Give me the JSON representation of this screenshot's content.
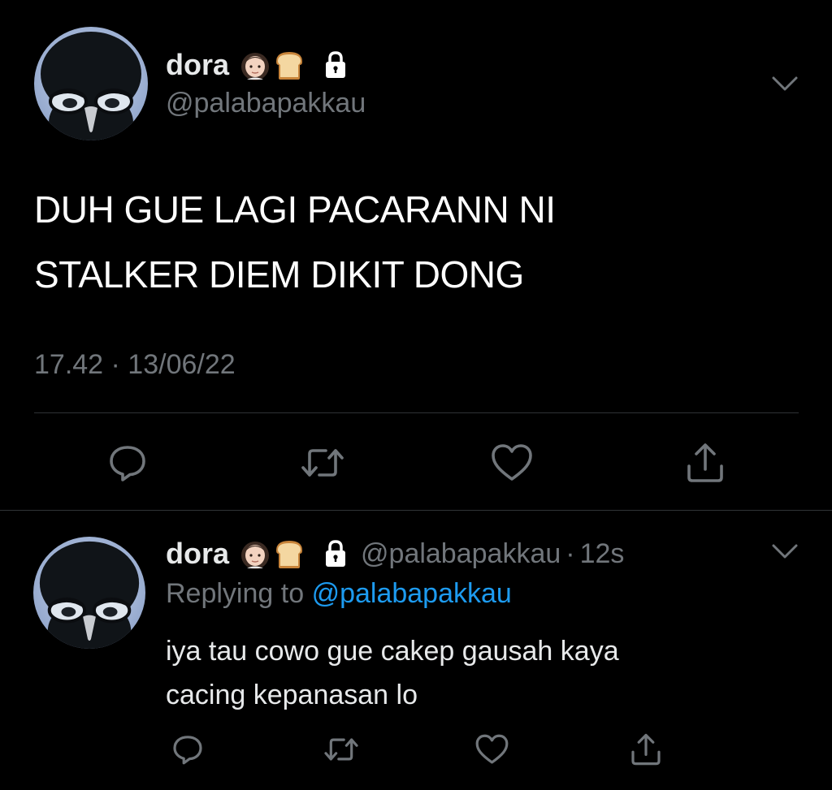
{
  "main_tweet": {
    "display_name": "dora",
    "handle": "@palabapakkau",
    "emoji": [
      "woman-emoji",
      "bread-emoji"
    ],
    "text_lines": [
      "DUH GUE LAGI PACARANN NI",
      "STALKER DIEM DIKIT DONG"
    ],
    "timestamp": "17.42 · 13/06/22"
  },
  "reply_tweet": {
    "display_name": "dora",
    "handle": "@palabapakkau",
    "separator": "·",
    "time_ago": "12s",
    "replying_prefix": "Replying to",
    "replying_mention": "@palabapakkau",
    "text_lines": [
      "iya tau cowo gue cakep gausah kaya",
      "cacing kepanasan lo"
    ]
  },
  "icons": {
    "reply": "reply-icon",
    "retweet": "retweet-icon",
    "like": "heart-icon",
    "share": "share-icon",
    "lock": "lock-icon",
    "more": "chevron-down-icon"
  },
  "colors": {
    "background": "#000000",
    "text_primary": "#e7e9ea",
    "text_secondary": "#71767b",
    "link": "#1d9bf0",
    "divider": "#2f3336"
  }
}
